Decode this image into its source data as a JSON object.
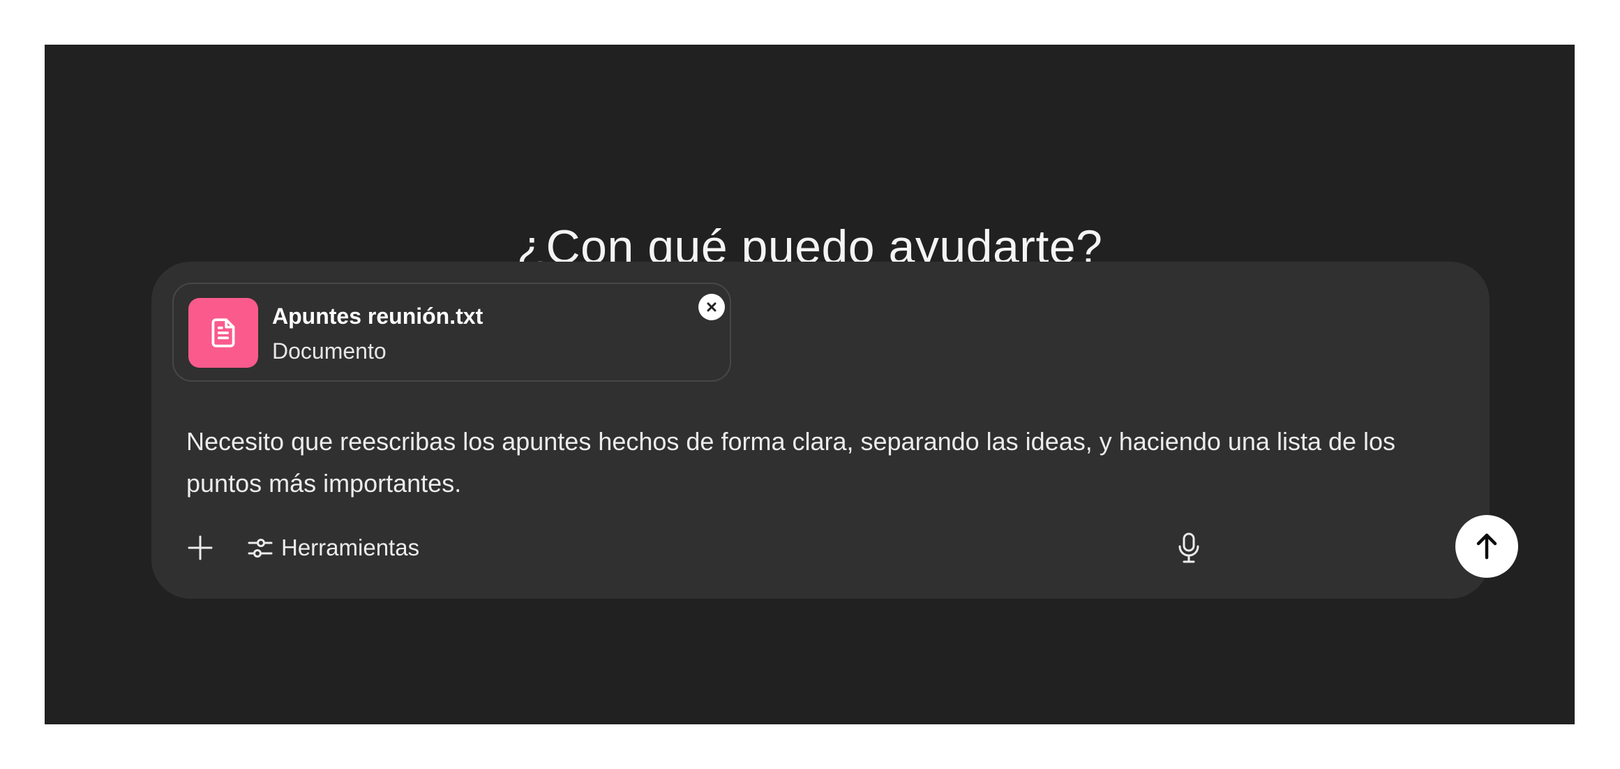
{
  "heading": "¿Con qué puedo ayudarte?",
  "attachment": {
    "file_name": "Apuntes reunión.txt",
    "file_type": "Documento",
    "icon": "document-icon",
    "icon_color": "#fa5b8c"
  },
  "prompt": {
    "value": "Necesito que reescribas los apuntes hechos de forma clara, separando las ideas, y haciendo una lista de los puntos más importantes."
  },
  "toolbar": {
    "add_icon": "plus-icon",
    "tools_icon": "sliders-icon",
    "tools_label": "Herramientas",
    "mic_icon": "microphone-icon",
    "send_icon": "arrow-up-icon"
  },
  "colors": {
    "background": "#212121",
    "composer": "#303030",
    "text": "#ececec"
  }
}
